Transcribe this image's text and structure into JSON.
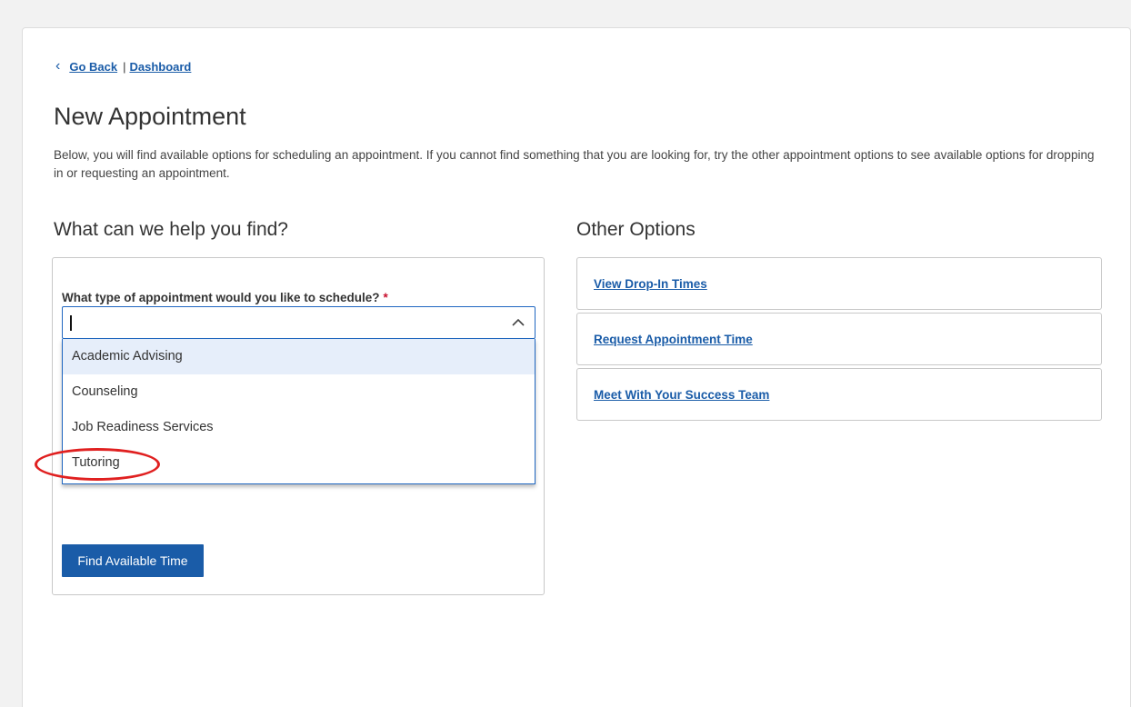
{
  "nav": {
    "back_label": "Go Back",
    "separator": "|",
    "dashboard_label": "Dashboard"
  },
  "page": {
    "title": "New Appointment",
    "intro": "Below, you will find available options for scheduling an appointment. If you cannot find something that you are looking for, try the other appointment options to see available options for dropping in or requesting an appointment."
  },
  "finder": {
    "heading": "What can we help you find?",
    "question": "What type of appointment would you like to schedule?",
    "required_mark": "*",
    "input_value": "",
    "options": [
      {
        "label": "Academic Advising"
      },
      {
        "label": "Counseling"
      },
      {
        "label": "Job Readiness Services"
      },
      {
        "label": "Tutoring"
      }
    ],
    "highlighted_option": "Academic Advising",
    "button_label": "Find Available Time"
  },
  "other_options": {
    "heading": "Other Options",
    "items": [
      {
        "label": "View Drop-In Times"
      },
      {
        "label": "Request Appointment Time"
      },
      {
        "label": "Meet With Your Success Team"
      }
    ]
  },
  "annotation": {
    "target": "Tutoring",
    "color": "#e02020"
  },
  "colors": {
    "link": "#1a5ca8",
    "primary_button": "#1a5ca8",
    "required": "#c8102e",
    "option_highlight": "#e6eefa"
  }
}
